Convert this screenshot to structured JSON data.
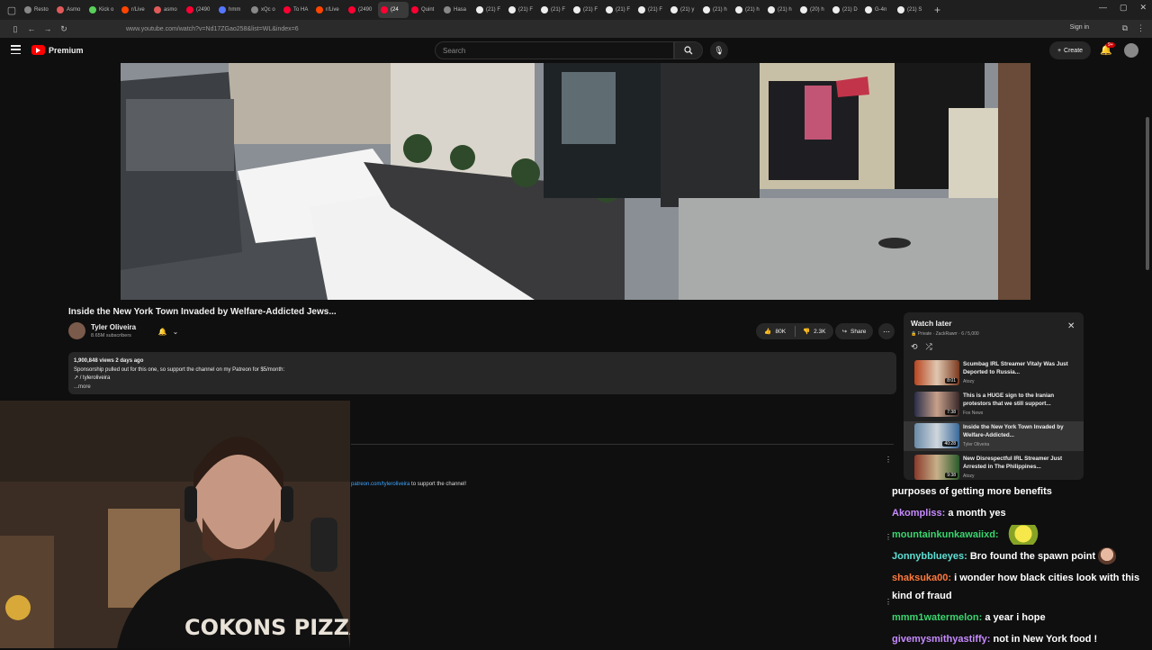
{
  "browser": {
    "tabs": [
      "Resto",
      "Asmo",
      "Kick o",
      "r/Live",
      "asmo",
      "(2490",
      "hmm",
      "xQc o",
      "To HA",
      "r/Live",
      "(2490",
      "(24",
      "Quint",
      "Hasa",
      "(21) F",
      "(21) F",
      "(21) F",
      "(21) F",
      "(21) F",
      "(21) F",
      "(21) y",
      "(21) h",
      "(21) h",
      "(21) h",
      "(20) h",
      "(21) D",
      "G-4n",
      "(21) S"
    ],
    "url": "www.youtube.com/watch?v=Nd17ZGao258&list=WL&index=6",
    "signin_label": "Sign in",
    "new_tab_label": "+"
  },
  "header": {
    "brand": "Premium",
    "search_placeholder": "Search",
    "create_label": "Create",
    "notif_badge": "9+"
  },
  "video": {
    "title": "Inside the New York Town Invaded by Welfare-Addicted Jews...",
    "channel": "Tyler Oliveira",
    "subscribers": "8.65M subscribers",
    "likes": "80K",
    "dislikes": "2.3K",
    "share_label": "Share"
  },
  "description": {
    "stats": "1,900,848 views  2 days ago",
    "line1": "Sponsorship pulled out for this one, so support the channel on my Patreon for $5/month:",
    "line2": "↗ / tyleroliveira",
    "more": "...more"
  },
  "pinned_comment": {
    "link": "patreon.com/tyleroliveira",
    "text": " to support the channel!"
  },
  "playlist": {
    "title": "Watch later",
    "meta": "🔒 Private · ZackRawrr · 6 / 5,000",
    "items": [
      {
        "title": "Scumbag IRL Streamer Vitaly Was Just Deported to Russia...",
        "channel": "Atozy",
        "duration": "8:01"
      },
      {
        "title": "This is a HUGE sign to the Iranian protestors that we still support...",
        "channel": "Fox News",
        "duration": "7:38"
      },
      {
        "title": "Inside the New York Town Invaded by Welfare-Addicted...",
        "channel": "Tyler Oliveira",
        "duration": "40:28"
      },
      {
        "title": "New Disrespectful IRL Streamer Just Arrested in The Philippines...",
        "channel": "Atozy",
        "duration": "9:38"
      }
    ]
  },
  "chat": [
    {
      "user": "",
      "color": "#ffffff",
      "text": "purposes of getting more benefits"
    },
    {
      "user": "Akompliss",
      "color": "#c78bff",
      "text": "a month yes"
    },
    {
      "user": "mountainkunkawaiixd",
      "color": "#3ad66f",
      "text": ""
    },
    {
      "user": "Jonnybblueyes",
      "color": "#5fe0d5",
      "text": "Bro found the spawn point"
    },
    {
      "user": "shaksuka00",
      "color": "#ff7a3d",
      "text": "i wonder how black cities look with this kind of fraud"
    },
    {
      "user": "mmm1watermelon",
      "color": "#3ad66f",
      "text": "a year i hope"
    },
    {
      "user": "givemysmithyastiffy",
      "color": "#c78bff",
      "text": "not in New York food !"
    }
  ]
}
